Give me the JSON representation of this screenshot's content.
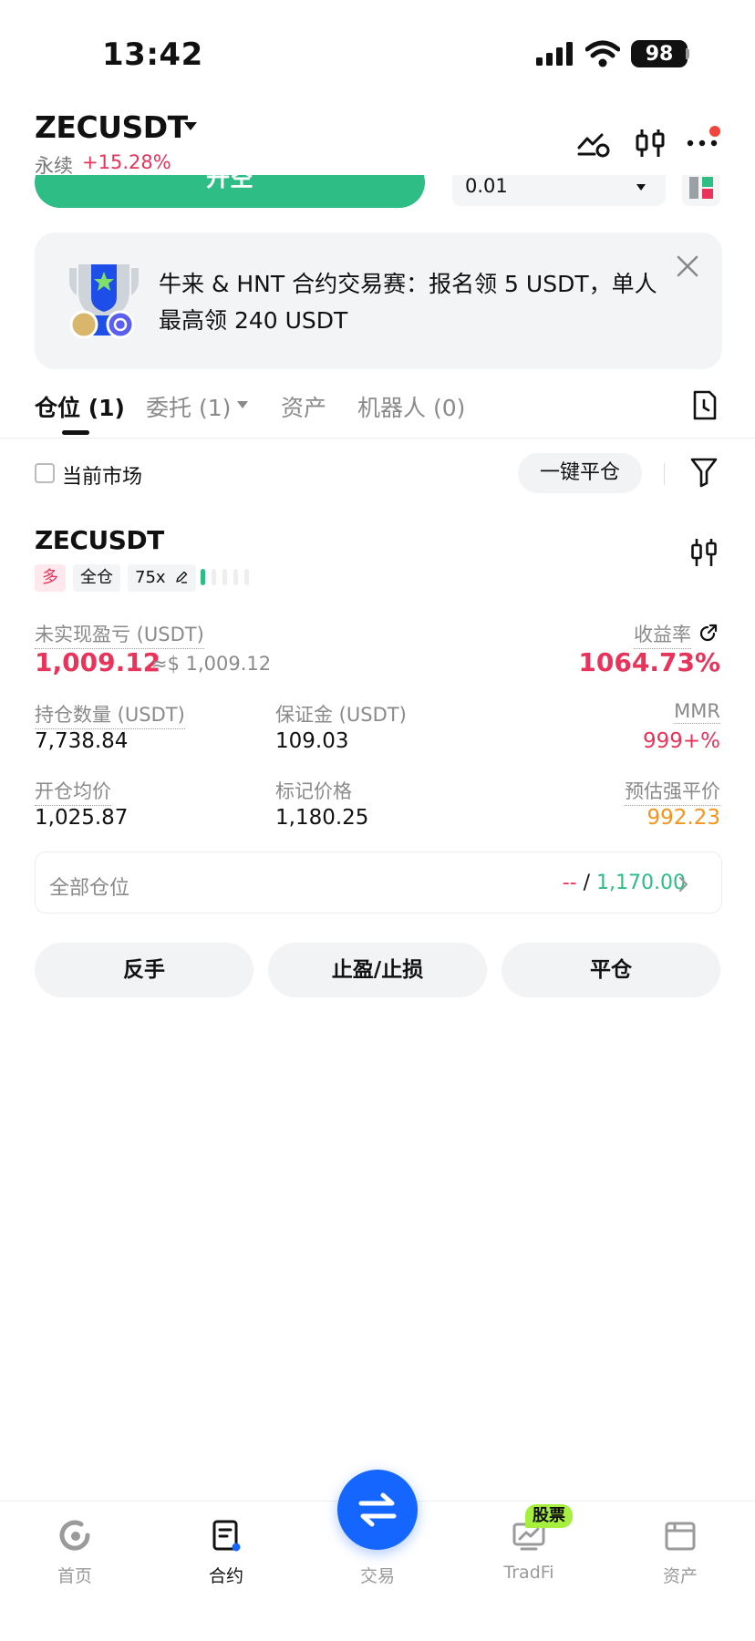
{
  "status_bar": {
    "time": "13:42",
    "battery": "98"
  },
  "header": {
    "pair": "ZECUSDT",
    "type_label": "永续",
    "change": "+15.28%"
  },
  "order_row": {
    "open_label": "开空",
    "qty": "0.01"
  },
  "banner": {
    "text": "牛来 & HNT 合约交易赛：报名领 5 USDT，单人最高领 240 USDT"
  },
  "tabs": [
    {
      "label": "仓位 (1)"
    },
    {
      "label": "委托 (1)"
    },
    {
      "label": "资产"
    },
    {
      "label": "机器人 (0)"
    }
  ],
  "filter": {
    "current_market": "当前市场",
    "close_all": "一键平仓"
  },
  "position": {
    "symbol": "ZECUSDT",
    "side": "多",
    "margin_mode": "全仓",
    "leverage": "75x",
    "risk_level": 0.2,
    "unrealized_pnl_label": "未实现盈亏 (USDT)",
    "unrealized_pnl": "1,009.12",
    "unrealized_pnl_usd": "≈$ 1,009.12",
    "roi_label": "收益率",
    "roi": "1064.73%",
    "size_label": "持仓数量 (USDT)",
    "size": "7,738.84",
    "margin_label": "保证金 (USDT)",
    "margin": "109.03",
    "mmr_label": "MMR",
    "mmr": "999+%",
    "entry_label": "开仓均价",
    "entry": "1,025.87",
    "mark_label": "标记价格",
    "mark": "1,180.25",
    "liq_label": "预估强平价",
    "liq": "992.23",
    "all_positions_label": "全部仓位",
    "all_positions_left": "--",
    "all_positions_sep": " / ",
    "all_positions_right": "1,170.00"
  },
  "actions": {
    "reverse": "反手",
    "tpsl": "止盈/止损",
    "close": "平仓"
  },
  "nav": [
    {
      "label": "首页"
    },
    {
      "label": "合约"
    },
    {
      "label": "交易"
    },
    {
      "label": "TradFi",
      "badge": "股票"
    },
    {
      "label": "资产"
    }
  ],
  "colors": {
    "green": "#2ebd85",
    "red": "#e8335a",
    "orange": "#f7931a",
    "blue": "#1566ff"
  }
}
